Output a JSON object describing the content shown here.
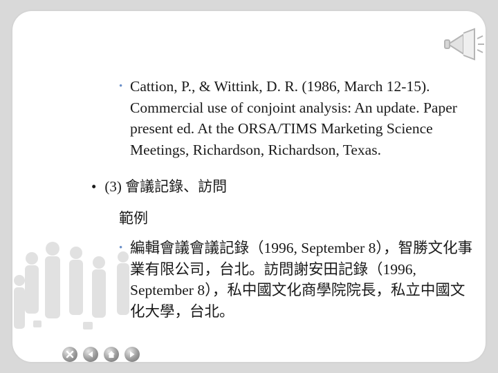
{
  "references": {
    "item1": "Cattion, P., & Wittink, D. R. (1986, March 12-15). Commercial use of conjoint analysis: An update. Paper present ed. At the ORSA/TIMS Marketing Science Meetings, Richardson, Richardson, Texas.",
    "section_heading": "(3) 會議記錄、訪問",
    "example_label": "範例",
    "item2": "編輯會議會議記錄（1996, September 8），智勝文化事業有限公司，台北。訪問謝安田記錄（1996, September 8），私中國文化商學院院長，私立中國文化大學，台北。"
  },
  "bullets": {
    "sub": "•",
    "main": "•"
  },
  "nav": [
    {
      "icon": "close-icon"
    },
    {
      "icon": "previous-icon"
    },
    {
      "icon": "home-icon"
    },
    {
      "icon": "next-icon"
    }
  ],
  "colors": {
    "background": "#d9d9d9",
    "slide": "#ffffff",
    "bullet_accent": "#6a8fc8",
    "text": "#1a1a1a"
  }
}
